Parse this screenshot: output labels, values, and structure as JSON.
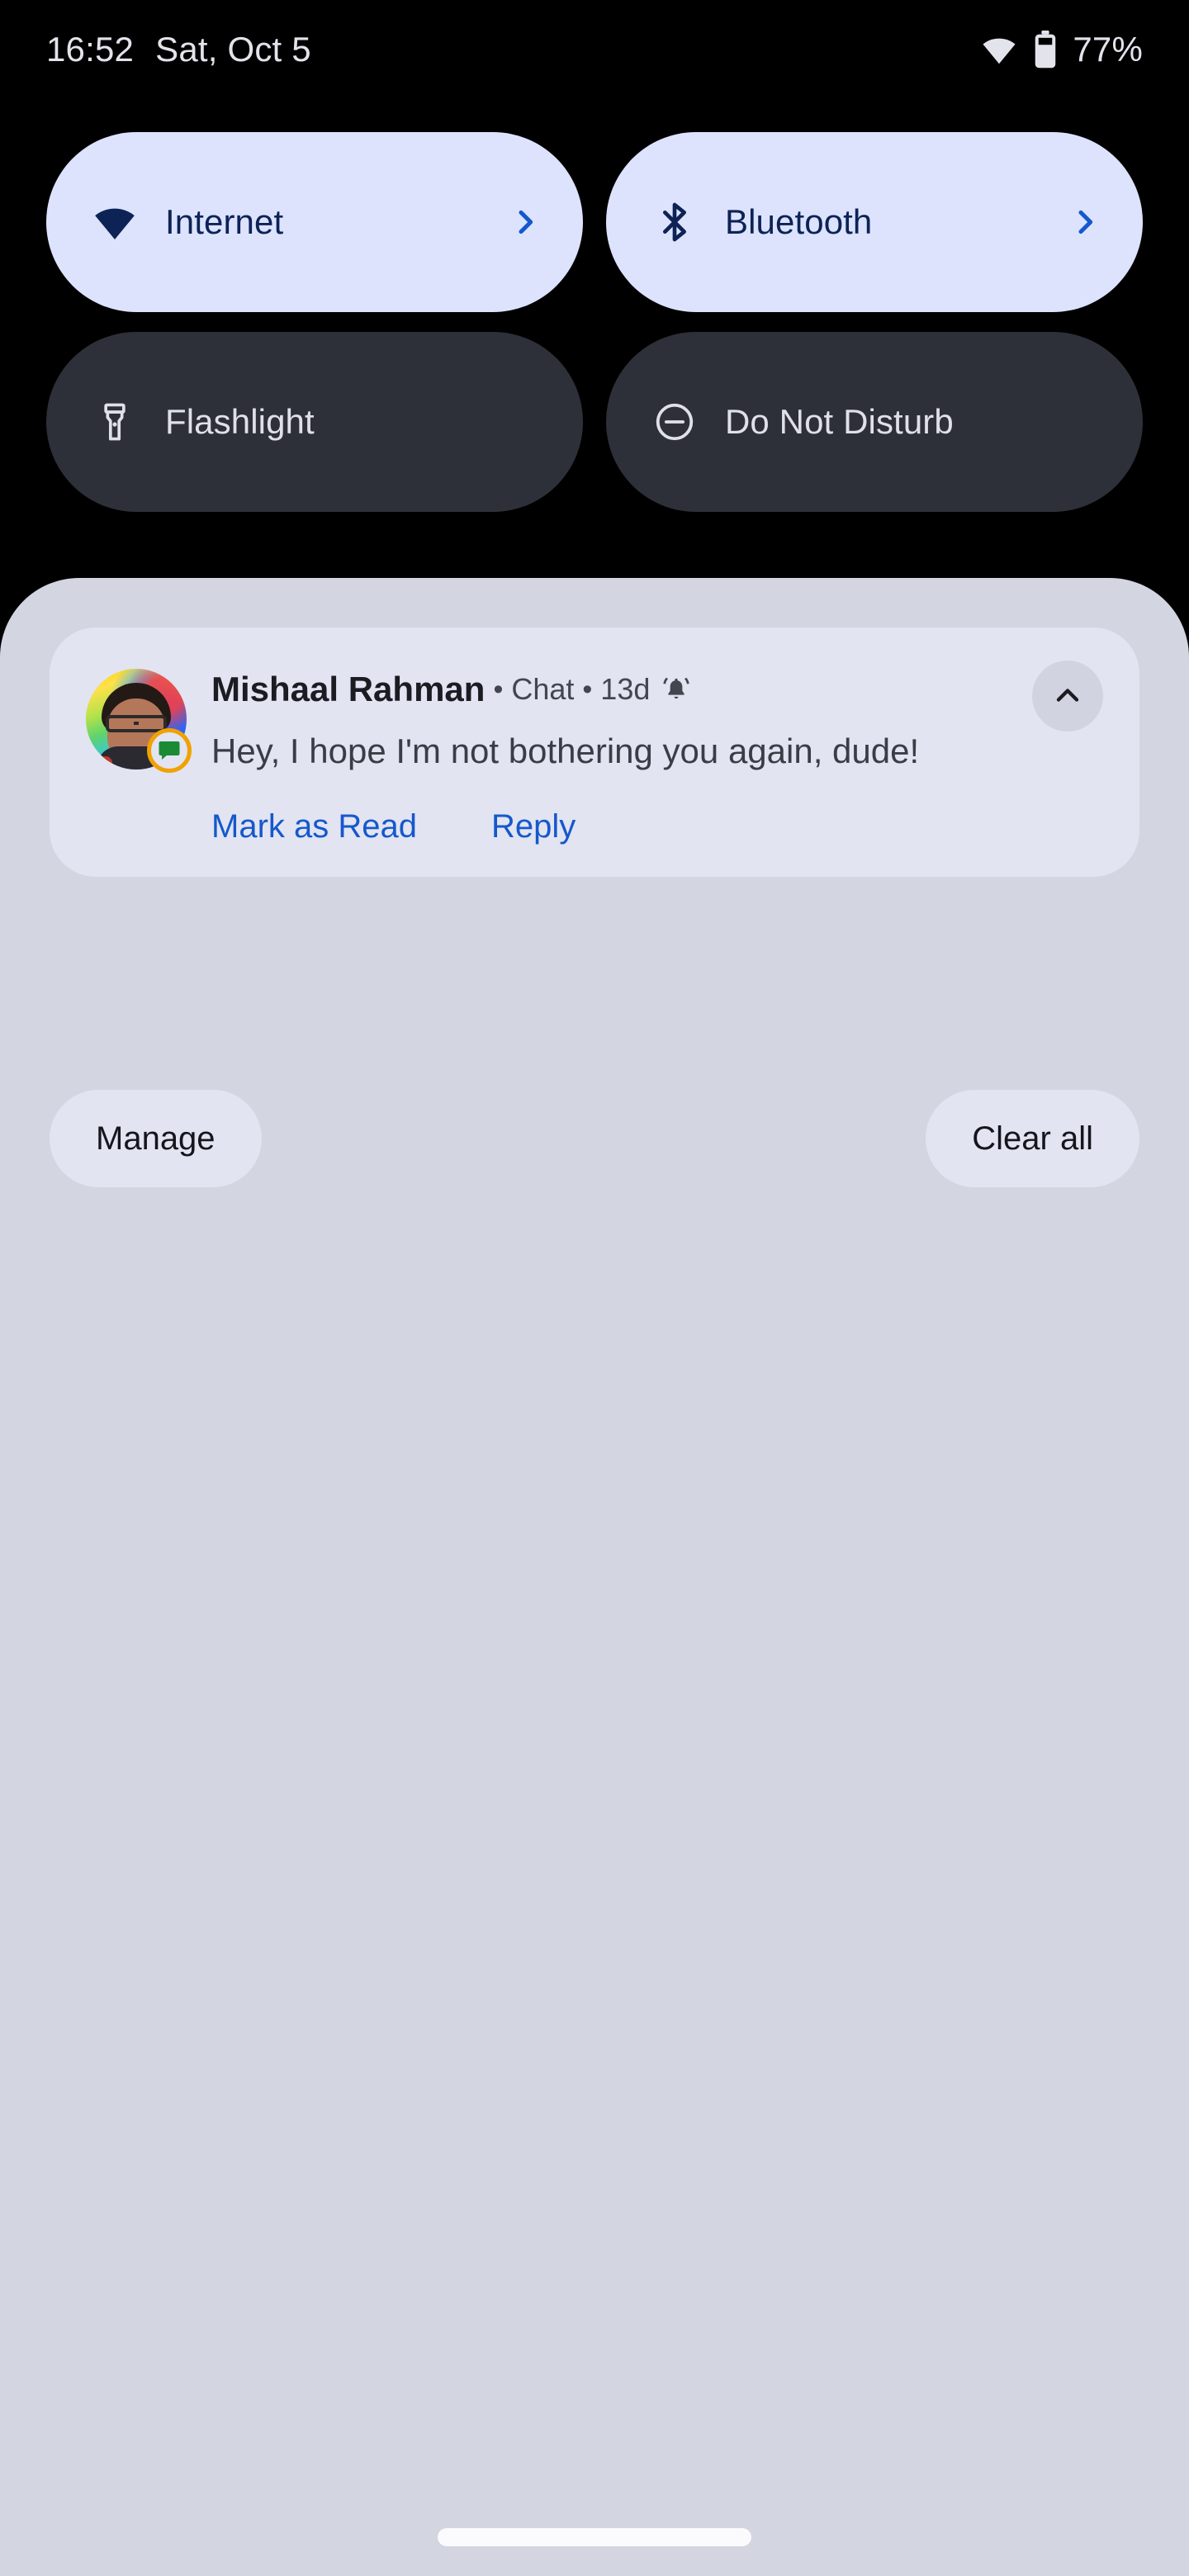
{
  "status_bar": {
    "time": "16:52",
    "date": "Sat, Oct 5",
    "battery_percent": "77%",
    "wifi_icon": "wifi-icon",
    "battery_icon": "battery-icon"
  },
  "quick_settings": {
    "tiles": [
      {
        "label": "Internet",
        "icon": "wifi-icon",
        "state": "active",
        "has_chevron": true
      },
      {
        "label": "Bluetooth",
        "icon": "bluetooth-icon",
        "state": "active",
        "has_chevron": true
      },
      {
        "label": "Flashlight",
        "icon": "flashlight-icon",
        "state": "inactive",
        "has_chevron": false
      },
      {
        "label": "Do Not Disturb",
        "icon": "do-not-disturb-icon",
        "state": "inactive",
        "has_chevron": false
      }
    ],
    "active_bg": "#dde3fd",
    "active_fg": "#0d2356",
    "inactive_bg": "#2e3039",
    "inactive_fg": "#dfe0ea",
    "chevron_color": "#1558cc"
  },
  "shade": {
    "background": "#d3d5e1",
    "card_background": "#e2e4f1",
    "notification": {
      "sender": "Mishaal Rahman",
      "separator": "•",
      "app_name": "Chat",
      "timestamp": "13d",
      "alert_icon": "bell-ringing-icon",
      "avatar_name": "avatar",
      "app_badge_icon": "google-messages-icon",
      "message": "Hey, I hope I'm not bothering you again, dude!",
      "collapse_icon": "chevron-up-icon",
      "actions": [
        {
          "label": "Mark as Read"
        },
        {
          "label": "Reply"
        }
      ],
      "action_color": "#1558cc"
    },
    "footer": {
      "manage_label": "Manage",
      "clear_all_label": "Clear all"
    }
  },
  "navigation": {
    "gesture_pill": "gesture-nav-pill"
  }
}
